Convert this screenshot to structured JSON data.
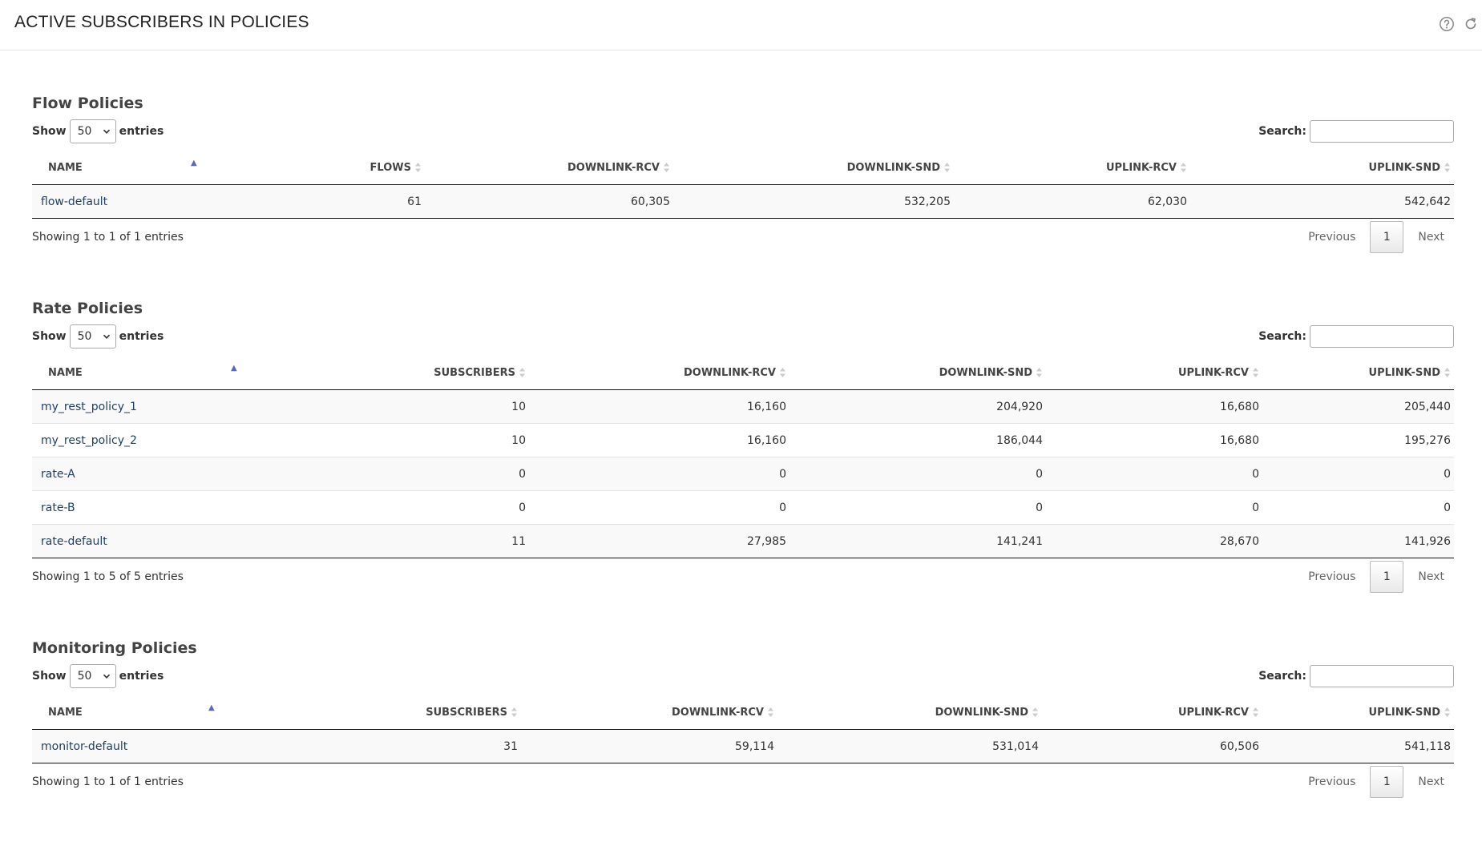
{
  "header": {
    "title": "ACTIVE SUBSCRIBERS IN POLICIES",
    "icons": [
      "help-icon",
      "refresh-icon"
    ]
  },
  "common": {
    "show_label": "Show",
    "entries_label": "entries",
    "search_label": "Search:",
    "page_length": "50",
    "prev_label": "Previous",
    "next_label": "Next",
    "current_page": "1",
    "accent_color": "#1f3f64"
  },
  "flow": {
    "title": "Flow Policies",
    "columns": [
      "NAME",
      "FLOWS",
      "DOWNLINK-RCV",
      "DOWNLINK-SND",
      "UPLINK-RCV",
      "UPLINK-SND"
    ],
    "rows": [
      [
        "flow-default",
        "61",
        "60,305",
        "532,205",
        "62,030",
        "542,642"
      ]
    ],
    "info": "Showing 1 to 1 of 1 entries"
  },
  "rate": {
    "title": "Rate Policies",
    "columns": [
      "NAME",
      "SUBSCRIBERS",
      "DOWNLINK-RCV",
      "DOWNLINK-SND",
      "UPLINK-RCV",
      "UPLINK-SND"
    ],
    "rows": [
      [
        "my_rest_policy_1",
        "10",
        "16,160",
        "204,920",
        "16,680",
        "205,440"
      ],
      [
        "my_rest_policy_2",
        "10",
        "16,160",
        "186,044",
        "16,680",
        "195,276"
      ],
      [
        "rate-A",
        "0",
        "0",
        "0",
        "0",
        "0"
      ],
      [
        "rate-B",
        "0",
        "0",
        "0",
        "0",
        "0"
      ],
      [
        "rate-default",
        "11",
        "27,985",
        "141,241",
        "28,670",
        "141,926"
      ]
    ],
    "info": "Showing 1 to 5 of 5 entries"
  },
  "monitoring": {
    "title": "Monitoring Policies",
    "columns": [
      "NAME",
      "SUBSCRIBERS",
      "DOWNLINK-RCV",
      "DOWNLINK-SND",
      "UPLINK-RCV",
      "UPLINK-SND"
    ],
    "rows": [
      [
        "monitor-default",
        "31",
        "59,114",
        "531,014",
        "60,506",
        "541,118"
      ]
    ],
    "info": "Showing 1 to 1 of 1 entries"
  }
}
